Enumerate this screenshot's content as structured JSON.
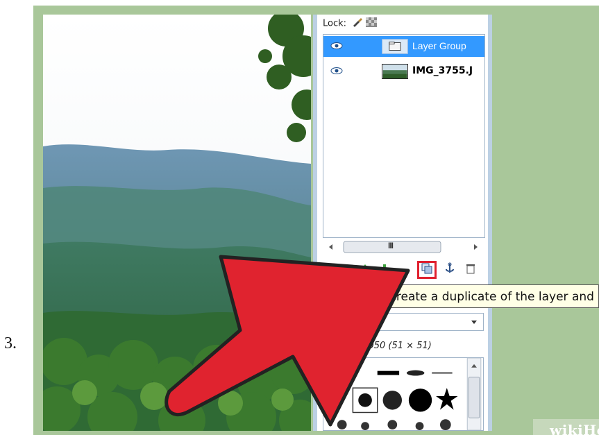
{
  "step": {
    "number": "3."
  },
  "layers_panel": {
    "lock_label": "Lock:",
    "layers": [
      {
        "name": "Layer Group",
        "selected": true,
        "thumb": "folder-icon"
      },
      {
        "name": "IMG_3755.J",
        "selected": false,
        "thumb": "landscape-thumbnail"
      }
    ],
    "scroll_thumb_label": "III"
  },
  "tooltip": {
    "text": "Create a duplicate of the layer and"
  },
  "brush": {
    "label": "ardness 050 (51 × 51)"
  },
  "watermark": {
    "text": "wikiHow"
  },
  "colors": {
    "frame": "#a9c79a",
    "selection": "#3399ff",
    "arrow": "#e0232f",
    "highlight": "#e0202e"
  }
}
